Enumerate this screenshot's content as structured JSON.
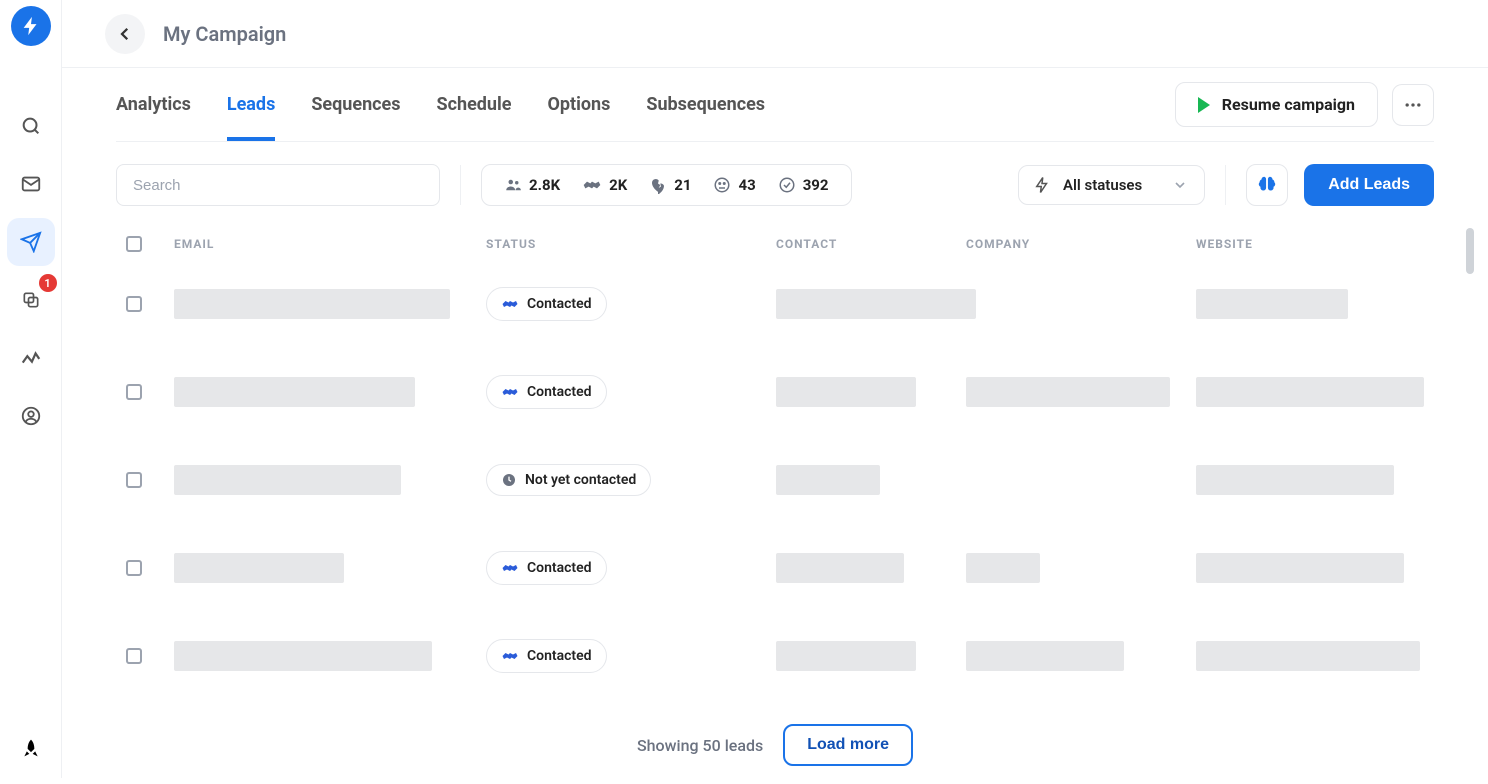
{
  "header": {
    "title": "My Campaign"
  },
  "sidebar": {
    "badge": "1"
  },
  "tabs": [
    "Analytics",
    "Leads",
    "Sequences",
    "Schedule",
    "Options",
    "Subsequences"
  ],
  "activeTab": "Leads",
  "actions": {
    "resume": "Resume campaign",
    "addLeads": "Add Leads"
  },
  "search": {
    "placeholder": "Search"
  },
  "stats": {
    "people": "2.8K",
    "handshake": "2K",
    "heartbreak": "21",
    "face": "43",
    "check": "392"
  },
  "statusFilter": {
    "label": "All statuses"
  },
  "table": {
    "headers": {
      "email": "EMAIL",
      "status": "STATUS",
      "contact": "CONTACT",
      "company": "COMPANY",
      "website": "WEBSITE"
    },
    "statuses": {
      "contacted": "Contacted",
      "notYet": "Not yet contacted"
    },
    "rows": [
      {
        "status": "contacted",
        "widths": {
          "email": 276,
          "contact": 200,
          "company": 0,
          "website": 152
        }
      },
      {
        "status": "contacted",
        "widths": {
          "email": 241,
          "contact": 140,
          "company": 204,
          "website": 228
        }
      },
      {
        "status": "notYet",
        "widths": {
          "email": 227,
          "contact": 104,
          "company": 0,
          "website": 198
        }
      },
      {
        "status": "contacted",
        "widths": {
          "email": 170,
          "contact": 128,
          "company": 74,
          "website": 208
        }
      },
      {
        "status": "contacted",
        "widths": {
          "email": 258,
          "contact": 140,
          "company": 158,
          "website": 224
        }
      }
    ],
    "footer": {
      "showing": "Showing 50 leads",
      "loadMore": "Load more"
    }
  }
}
